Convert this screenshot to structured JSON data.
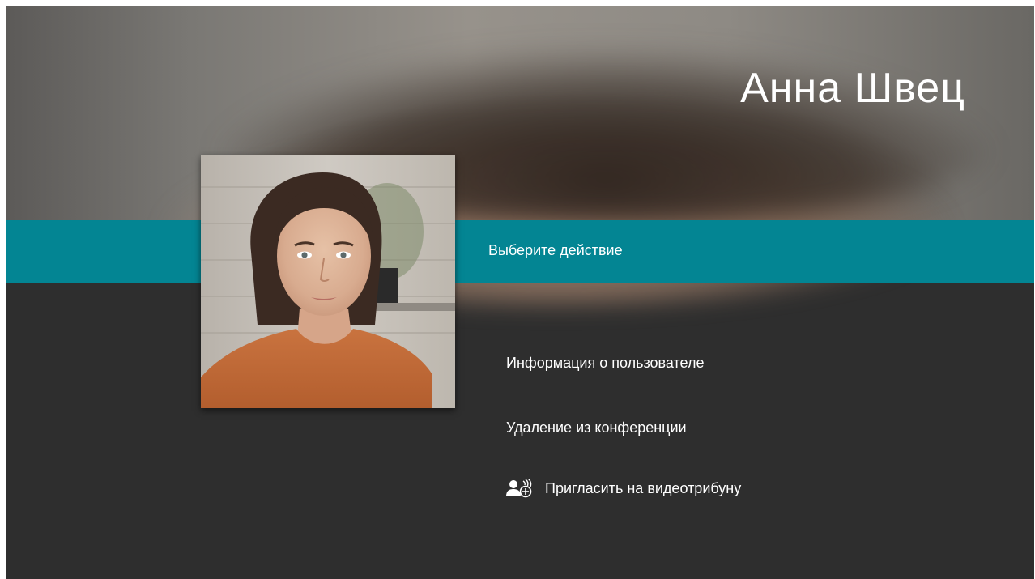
{
  "header": {
    "user_name": "Анна Швец"
  },
  "action_bar": {
    "label": "Выберите действие"
  },
  "menu": {
    "items": [
      {
        "label": "Информация о пользователе",
        "icon": null
      },
      {
        "label": "Удаление из конференции",
        "icon": null
      },
      {
        "label": "Пригласить на видеотрибуну",
        "icon": "invite-to-podium-icon"
      }
    ]
  },
  "colors": {
    "accent": "#038593",
    "background": "#2e2e2e",
    "text": "#ffffff"
  }
}
